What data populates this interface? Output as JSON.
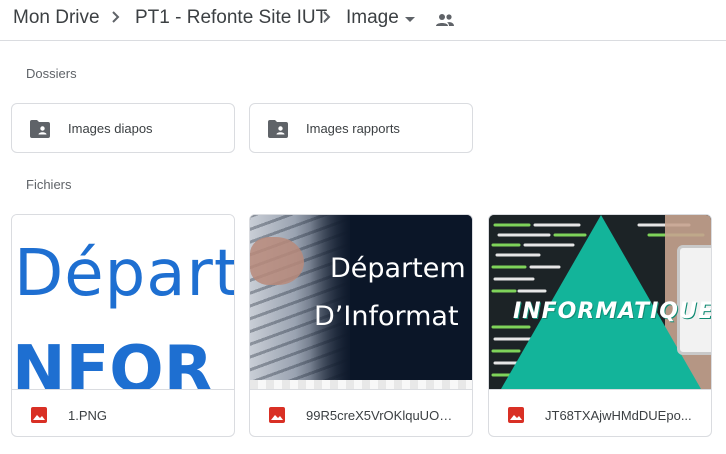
{
  "breadcrumb": {
    "items": [
      "Mon Drive",
      "PT1 - Refonte Site IUT",
      "Image"
    ],
    "dropdown_icon": "arrow-drop-down-icon",
    "shared_icon": "people-icon"
  },
  "sections": {
    "folders_label": "Dossiers",
    "files_label": "Fichiers"
  },
  "folders": [
    {
      "name": "Images diapos",
      "icon": "shared-folder-icon"
    },
    {
      "name": "Images rapports",
      "icon": "shared-folder-icon"
    }
  ],
  "files": [
    {
      "name": "1.PNG",
      "icon": "image-file-icon",
      "thumb_text": [
        "Départ",
        "NFOR"
      ]
    },
    {
      "name": "99R5creX5VrOKlquUO_l...",
      "icon": "image-file-icon",
      "thumb_text": [
        "Départem",
        "D’Informat"
      ]
    },
    {
      "name": "JT68TXAjwHMdDUEpo...",
      "icon": "image-file-icon",
      "thumb_text": [
        "INFORMATIQUE"
      ]
    }
  ],
  "colors": {
    "text": "#3c4043",
    "secondary_text": "#5f6368",
    "border": "#dadce0",
    "image_icon_red": "#d93025",
    "thumb1_blue": "#1e6fd1",
    "thumb3_teal": "#13b49a"
  }
}
